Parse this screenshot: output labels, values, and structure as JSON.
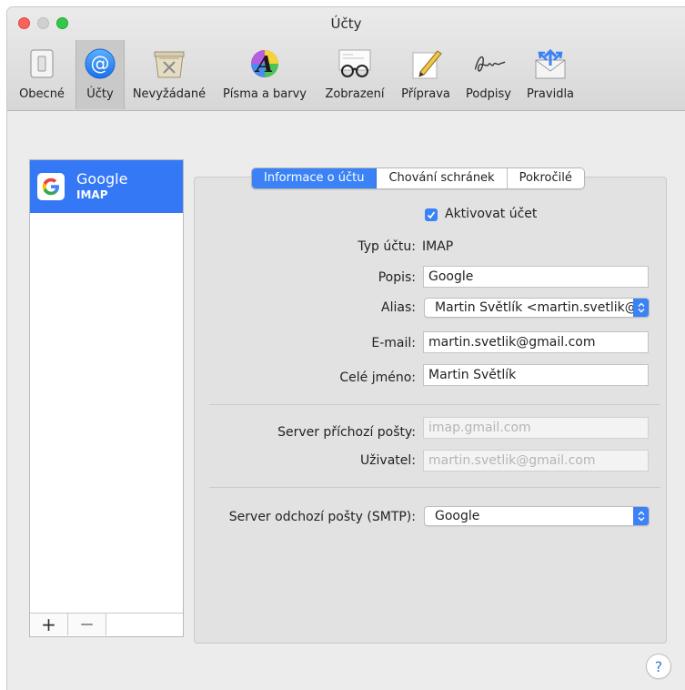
{
  "window": {
    "title": "Účty"
  },
  "toolbar": {
    "items": [
      {
        "label": "Obecné",
        "icon": "switch-icon"
      },
      {
        "label": "Účty",
        "icon": "at-sign-icon",
        "selected": true
      },
      {
        "label": "Nevyžádané",
        "icon": "trash-bin-icon"
      },
      {
        "label": "Písma a barvy",
        "icon": "font-color-icon"
      },
      {
        "label": "Zobrazení",
        "icon": "glasses-icon"
      },
      {
        "label": "Příprava",
        "icon": "pencil-paper-icon"
      },
      {
        "label": "Podpisy",
        "icon": "signature-icon"
      },
      {
        "label": "Pravidla",
        "icon": "rules-envelope-icon"
      }
    ]
  },
  "accounts": {
    "items": [
      {
        "name": "Google",
        "type": "IMAP",
        "icon": "google-icon"
      }
    ],
    "add_label": "+",
    "remove_label": "—"
  },
  "tabs": [
    {
      "label": "Informace o účtu",
      "active": true
    },
    {
      "label": "Chování schránek"
    },
    {
      "label": "Pokročilé"
    }
  ],
  "form": {
    "enable_label": "Aktivovat účet",
    "enable_checked": true,
    "type_label": "Typ účtu:",
    "type_value": "IMAP",
    "description_label": "Popis:",
    "description_value": "Google",
    "alias_label": "Alias:",
    "alias_value": "Martin Světlík <martin.svetlik@gmail.com>",
    "email_label": "E-mail:",
    "email_value": "martin.svetlik@gmail.com",
    "fullname_label": "Celé jméno:",
    "fullname_value": "Martin Světlík",
    "incoming_label": "Server příchozí pošty:",
    "incoming_value": "imap.gmail.com",
    "user_label": "Uživatel:",
    "user_value": "martin.svetlik@gmail.com",
    "smtp_label": "Server odchozí pošty (SMTP):",
    "smtp_value": "Google"
  },
  "help_label": "?",
  "colors": {
    "accent": "#3a82f6",
    "selection": "#3478f6"
  }
}
